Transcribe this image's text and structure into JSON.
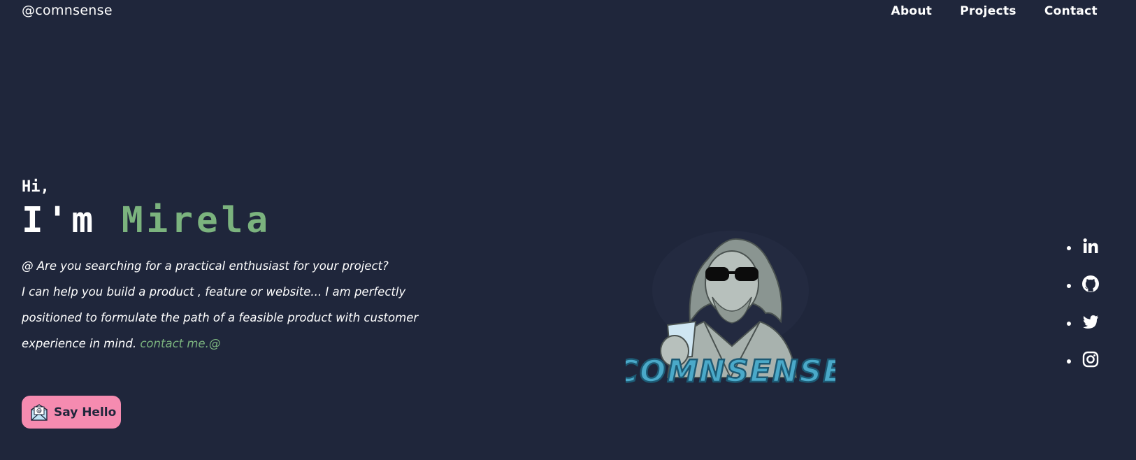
{
  "header": {
    "brand": "@comnsense",
    "nav": [
      "About",
      "Projects",
      "Contact"
    ]
  },
  "hero": {
    "greeting": "Hi,",
    "im": "I'm ",
    "name": "Mirela",
    "bio_lines": [
      "@ Are you searching for a practical enthusiast for your project?",
      "I can help you build a product , feature or website... I am perfectly positioned to formulate the path of a feasible product with customer experience in mind. "
    ],
    "contact_link": "contact me.@",
    "cta": "Say Hello"
  },
  "logo": {
    "text": "COMNSENSE"
  },
  "social": [
    "linkedin-icon",
    "github-icon",
    "twitter-icon",
    "instagram-icon"
  ],
  "colors": {
    "background": "#1f263b",
    "accent": "#7bb37e",
    "cta": "#f58bb0",
    "text": "#ffffff"
  }
}
